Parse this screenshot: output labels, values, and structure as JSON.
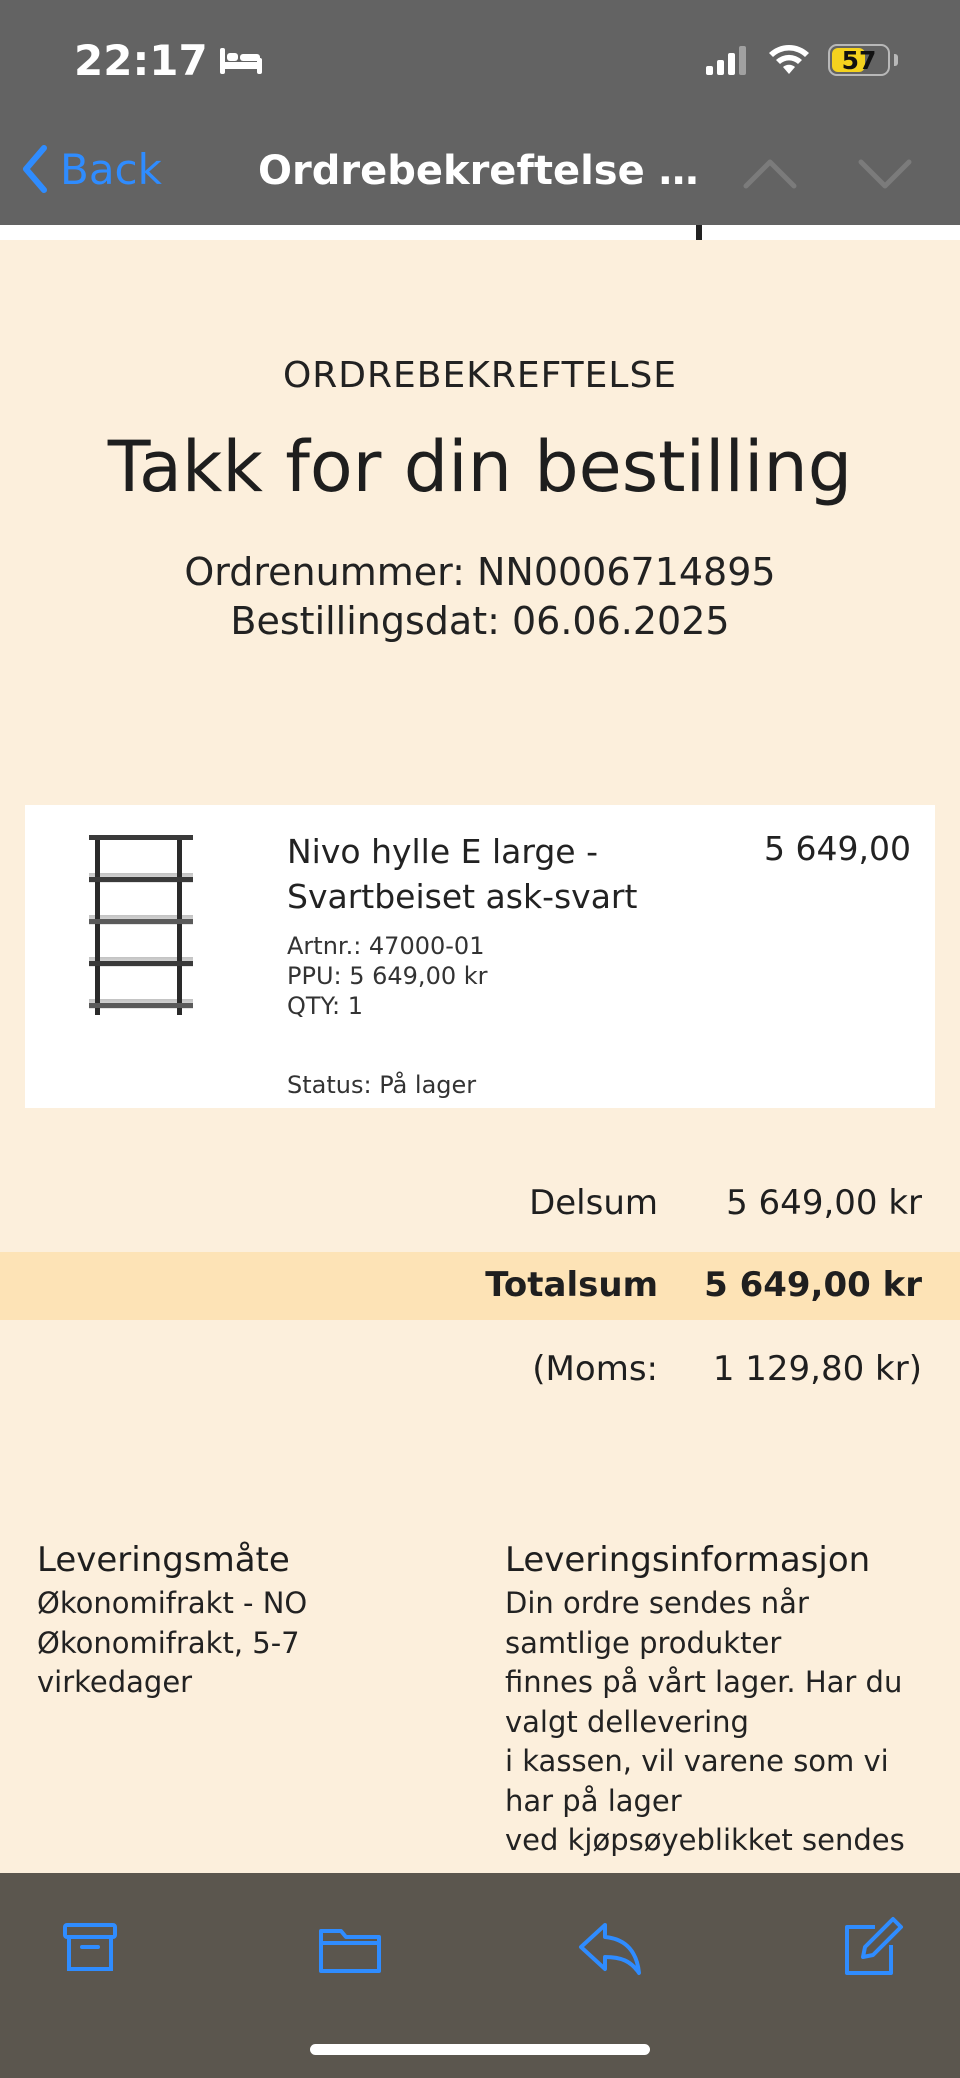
{
  "status_bar": {
    "time": "22:17",
    "battery_level": "57"
  },
  "nav": {
    "back_label": "Back",
    "title": "Ordrebekreftelse NN..."
  },
  "email": {
    "kicker": "ORDREBEKREFTELSE",
    "headline": "Takk for din bestilling",
    "order_number": "Ordrenummer: NN0006714895",
    "order_date": "Bestillingsdat: 06.06.2025",
    "product": {
      "name": "Nivo hylle E large - Svartbeiset ask-svart",
      "artnr": "Artnr.: 47000-01",
      "ppu": "PPU:  5 649,00 kr",
      "qty": "QTY: 1",
      "status": "Status: På lager",
      "price": "5 649,00"
    },
    "summary": {
      "subtotal_label": "Delsum",
      "subtotal_value": "5 649,00 kr",
      "total_label": "Totalsum",
      "total_value": "5 649,00 kr",
      "vat_label": "(Moms:",
      "vat_value": "1 129,80 kr)"
    },
    "delivery_method": {
      "heading": "Leveringsmåte",
      "lines": [
        "Økonomifrakt - NO",
        "Økonomifrakt, 5-7",
        "virkedager"
      ]
    },
    "delivery_info": {
      "heading": "Leveringsinformasjon",
      "lines": [
        "Din ordre sendes når",
        "samtlige produkter",
        "finnes på vårt lager. Har du",
        "valgt dellevering",
        "i kassen, vil varene som vi",
        "har på lager",
        "ved kjøpsøyeblikket sendes"
      ]
    }
  },
  "colors": {
    "accent": "#2f8cff",
    "background": "#fcefdc",
    "total_highlight": "#fde3b6",
    "bar_gray": "#636363",
    "toolbar": "#5b564e"
  },
  "toolbar": {
    "icons": [
      "archive-icon",
      "folder-icon",
      "reply-icon",
      "compose-icon"
    ]
  }
}
